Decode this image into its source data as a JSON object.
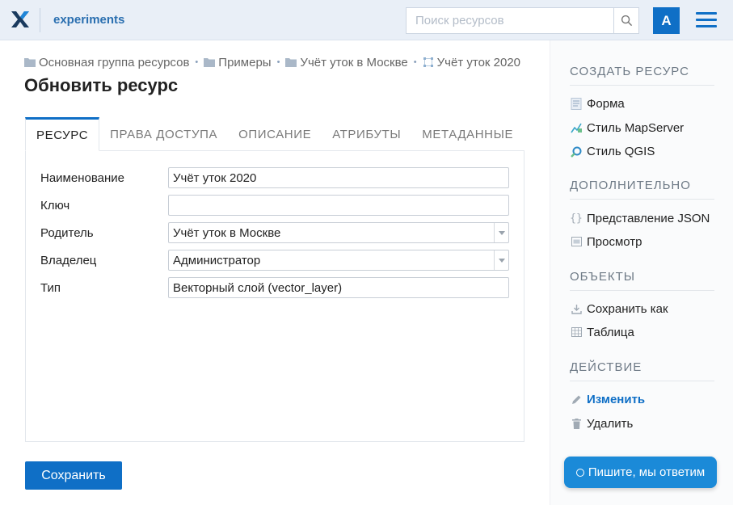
{
  "header": {
    "app_title": "experiments",
    "search_placeholder": "Поиск ресурсов",
    "avatar_letter": "А",
    "colors": {
      "accent": "#0f6fc6",
      "header_bg": "#e9eff7"
    }
  },
  "breadcrumb": [
    {
      "label": "Основная группа ресурсов",
      "icon": "folder-icon"
    },
    {
      "label": "Примеры",
      "icon": "folder-icon"
    },
    {
      "label": "Учёт уток в Москве",
      "icon": "folder-icon"
    },
    {
      "label": "Учёт уток 2020",
      "icon": "vector-layer-icon"
    }
  ],
  "page_title": "Обновить ресурс",
  "tabs": [
    {
      "label": "РЕСУРС",
      "active": true
    },
    {
      "label": "ПРАВА ДОСТУПА",
      "active": false
    },
    {
      "label": "ОПИСАНИЕ",
      "active": false
    },
    {
      "label": "АТРИБУТЫ",
      "active": false
    },
    {
      "label": "МЕТАДАННЫЕ",
      "active": false
    }
  ],
  "form": {
    "name": {
      "label": "Наименование",
      "value": "Учёт уток 2020"
    },
    "key": {
      "label": "Ключ",
      "value": ""
    },
    "parent": {
      "label": "Родитель",
      "value": "Учёт уток в Москве"
    },
    "owner": {
      "label": "Владелец",
      "value": "Администратор"
    },
    "type": {
      "label": "Тип",
      "value": "Векторный слой (vector_layer)"
    }
  },
  "save_label": "Сохранить",
  "sidebar": {
    "create": {
      "title": "СОЗДАТЬ РЕСУРС",
      "items": [
        {
          "label": "Форма",
          "icon": "form-icon"
        },
        {
          "label": "Стиль MapServer",
          "icon": "mapserver-style-icon"
        },
        {
          "label": "Стиль QGIS",
          "icon": "qgis-style-icon"
        }
      ]
    },
    "extra": {
      "title": "ДОПОЛНИТЕЛЬНО",
      "items": [
        {
          "label": "Представление JSON",
          "icon": "json-icon"
        },
        {
          "label": "Просмотр",
          "icon": "preview-icon"
        }
      ]
    },
    "objects": {
      "title": "ОБЪЕКТЫ",
      "items": [
        {
          "label": "Сохранить как",
          "icon": "download-icon"
        },
        {
          "label": "Таблица",
          "icon": "table-icon"
        }
      ]
    },
    "action": {
      "title": "ДЕЙСТВИЕ",
      "items": [
        {
          "label": "Изменить",
          "icon": "pencil-icon",
          "active": true
        },
        {
          "label": "Удалить",
          "icon": "trash-icon"
        }
      ]
    }
  },
  "chat_label": "Пишите, мы ответим"
}
